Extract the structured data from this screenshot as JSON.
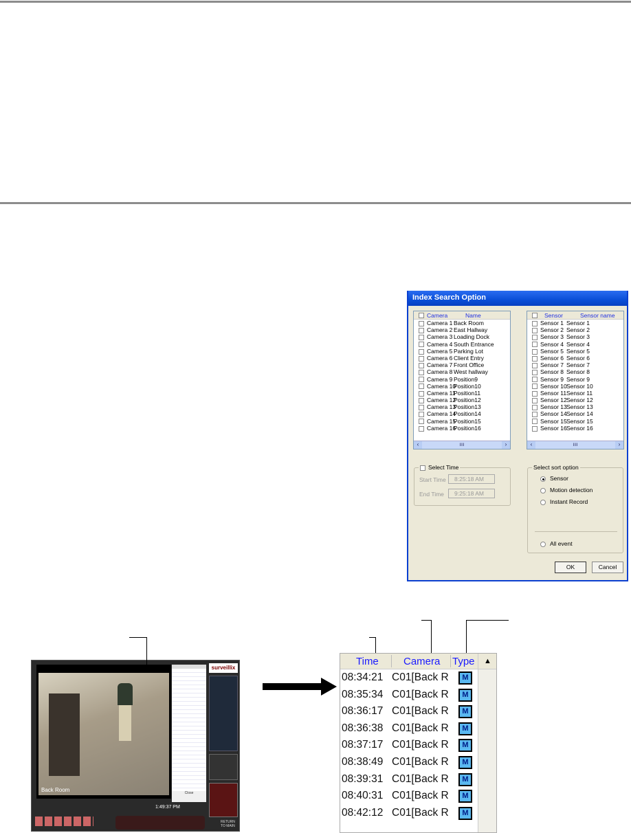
{
  "dialog": {
    "title": "Index Search Option",
    "camera_list": {
      "headers": [
        "Camera",
        "Name"
      ],
      "rows": [
        [
          "Camera 1",
          "Back Room"
        ],
        [
          "Camera 2",
          "East Hallway"
        ],
        [
          "Camera 3",
          "Loading Dock"
        ],
        [
          "Camera 4",
          "South Entrance"
        ],
        [
          "Camera 5",
          "Parking Lot"
        ],
        [
          "Camera 6",
          "Client Entry"
        ],
        [
          "Camera 7",
          "Front Office"
        ],
        [
          "Camera 8",
          "West hallway"
        ],
        [
          "Camera 9",
          "Position9"
        ],
        [
          "Camera 10",
          "Position10"
        ],
        [
          "Camera 11",
          "Position11"
        ],
        [
          "Camera 12",
          "Position12"
        ],
        [
          "Camera 13",
          "Position13"
        ],
        [
          "Camera 14",
          "Position14"
        ],
        [
          "Camera 15",
          "Position15"
        ],
        [
          "Camera 16",
          "Position16"
        ]
      ]
    },
    "sensor_list": {
      "headers": [
        "Sensor",
        "Sensor name"
      ],
      "rows": [
        [
          "Sensor 1",
          "Sensor 1"
        ],
        [
          "Sensor 2",
          "Sensor 2"
        ],
        [
          "Sensor 3",
          "Sensor 3"
        ],
        [
          "Sensor 4",
          "Sensor 4"
        ],
        [
          "Sensor 5",
          "Sensor 5"
        ],
        [
          "Sensor 6",
          "Sensor 6"
        ],
        [
          "Sensor 7",
          "Sensor 7"
        ],
        [
          "Sensor 8",
          "Sensor 8"
        ],
        [
          "Sensor 9",
          "Sensor 9"
        ],
        [
          "Sensor 10",
          "Sensor 10"
        ],
        [
          "Sensor 11",
          "Sensor 11"
        ],
        [
          "Sensor 12",
          "Sensor 12"
        ],
        [
          "Sensor 13",
          "Sensor 13"
        ],
        [
          "Sensor 14",
          "Sensor 14"
        ],
        [
          "Sensor 15",
          "Sensor 15"
        ],
        [
          "Sensor 16",
          "Sensor 16"
        ]
      ]
    },
    "select_time": {
      "label": "Select Time",
      "start_label": "Start Time",
      "start_value": "8:25:18 AM",
      "end_label": "End Time",
      "end_value": "9:25:18 AM"
    },
    "sort": {
      "label": "Select sort option",
      "options": [
        "Sensor",
        "Motion detection",
        "Instant Record"
      ],
      "selected": "Sensor",
      "all_event": "All event"
    },
    "ok": "OK",
    "cancel": "Cancel"
  },
  "dvr": {
    "brand": "surveillix",
    "camera_label": "Back Room",
    "clock": "1:49:37 PM",
    "close": "Close",
    "return": "RETURN TO MAIN"
  },
  "event_list": {
    "headers": [
      "Time",
      "Camera",
      "Type"
    ],
    "rows": [
      {
        "time": "08:34:21",
        "camera": "C01[Back R",
        "type": "M"
      },
      {
        "time": "08:35:34",
        "camera": "C01[Back R",
        "type": "M"
      },
      {
        "time": "08:36:17",
        "camera": "C01[Back R",
        "type": "M"
      },
      {
        "time": "08:36:38",
        "camera": "C01[Back R",
        "type": "M"
      },
      {
        "time": "08:37:17",
        "camera": "C01[Back R",
        "type": "M"
      },
      {
        "time": "08:38:49",
        "camera": "C01[Back R",
        "type": "M"
      },
      {
        "time": "08:39:31",
        "camera": "C01[Back R",
        "type": "M"
      },
      {
        "time": "08:40:31",
        "camera": "C01[Back R",
        "type": "M"
      },
      {
        "time": "08:42:12",
        "camera": "C01[Back R",
        "type": "M"
      }
    ]
  }
}
